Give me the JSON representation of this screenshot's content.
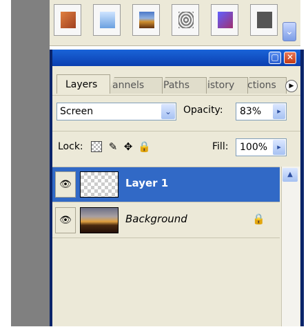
{
  "swatches": [
    {
      "name": "swatch-orange-style",
      "color": "#c86a3a"
    },
    {
      "name": "swatch-blue-style",
      "color": "#8ab4e6"
    },
    {
      "name": "swatch-landscape-style",
      "color": "#c8a060"
    },
    {
      "name": "swatch-texture-style",
      "color": "#aaaaaa"
    },
    {
      "name": "swatch-purple-style",
      "color": "#6a4aa0"
    },
    {
      "name": "swatch-gray-style",
      "color": "#555555"
    }
  ],
  "panel": {
    "minimize_glyph": "▢",
    "close_glyph": "✕",
    "tabs": [
      "Layers",
      "annels",
      "Paths",
      "istory",
      "ctions"
    ],
    "menu_glyph": "▶",
    "blend_mode": "Screen",
    "opacity_label": "Opacity:",
    "opacity_value": "83%",
    "lock_label": "Lock:",
    "fill_label": "Fill:",
    "fill_value": "100%"
  },
  "layers": [
    {
      "name": "Layer 1",
      "selected": true
    },
    {
      "name": "Background",
      "selected": false,
      "locked": true
    }
  ],
  "glyphs": {
    "eye": "👁",
    "lock": "🔒",
    "dropdown": "⌄",
    "arrow": "▸",
    "brush": "✎",
    "move": "✥",
    "up": "▲"
  }
}
